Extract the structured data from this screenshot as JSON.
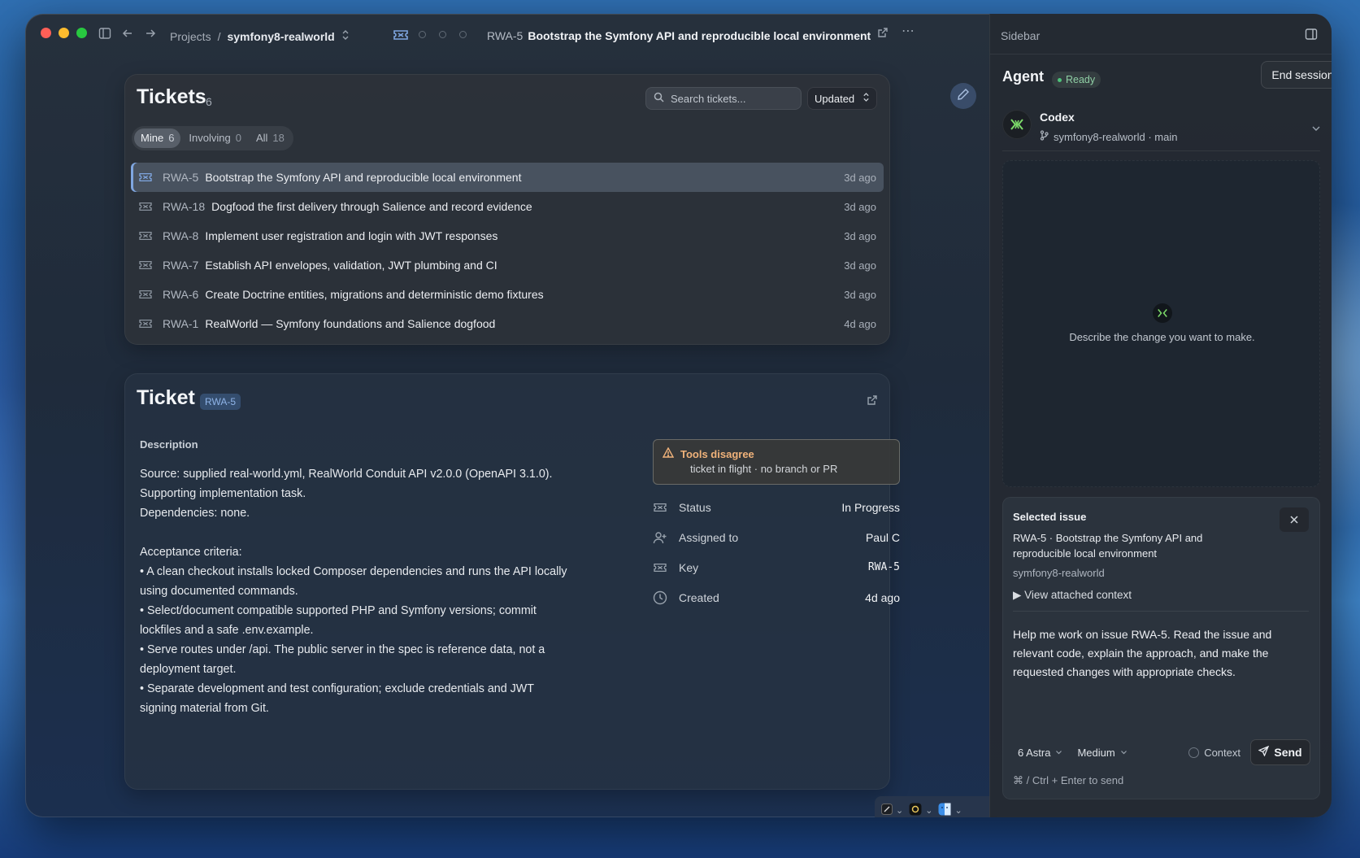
{
  "titlebar": {
    "breadcrumb_projects": "Projects",
    "breadcrumb_sep": "/",
    "breadcrumb_repo": "symfony8-realworld",
    "ticket_key": "RWA-5",
    "ticket_title": "Bootstrap the Symfony API and reproducible local environment"
  },
  "tickets": {
    "title": "Tickets",
    "count": "6",
    "search_placeholder": "Search tickets...",
    "sort_label": "Updated",
    "filters": [
      {
        "label": "Mine",
        "count": "6"
      },
      {
        "label": "Involving",
        "count": "0"
      },
      {
        "label": "All",
        "count": "18"
      }
    ],
    "rows": [
      {
        "key": "RWA-5",
        "title": "Bootstrap the Symfony API and reproducible local environment",
        "time": "3d ago"
      },
      {
        "key": "RWA-18",
        "title": "Dogfood the first delivery through Salience and record evidence",
        "time": "3d ago"
      },
      {
        "key": "RWA-8",
        "title": "Implement user registration and login with JWT responses",
        "time": "3d ago"
      },
      {
        "key": "RWA-7",
        "title": "Establish API envelopes, validation, JWT plumbing and CI",
        "time": "3d ago"
      },
      {
        "key": "RWA-6",
        "title": "Create Doctrine entities, migrations and deterministic demo fixtures",
        "time": "3d ago"
      },
      {
        "key": "RWA-1",
        "title": "RealWorld — Symfony foundations and Salience dogfood",
        "time": "4d ago"
      }
    ]
  },
  "ticket": {
    "title": "Ticket",
    "key": "RWA-5",
    "description_label": "Description",
    "description": "Source: supplied real-world.yml, RealWorld Conduit API v2.0.0 (OpenAPI 3.1.0).\nSupporting implementation task.\nDependencies: none.\n\nAcceptance criteria:\n• A clean checkout installs locked Composer dependencies and runs the API locally\nusing documented commands.\n• Select/document compatible supported PHP and Symfony versions; commit\nlockfiles and a safe .env.example.\n• Serve routes under /api. The public server in the spec is reference data, not a\ndeployment target.\n• Separate development and test configuration; exclude credentials and JWT\nsigning material from Git.",
    "warning_title": "Tools disagree",
    "warning_text": "ticket in flight · no branch or PR",
    "props": {
      "status_label": "Status",
      "status_value": "In Progress",
      "assigned_label": "Assigned to",
      "assigned_value": "Paul C",
      "key_label": "Key",
      "key_value": "RWA-5",
      "created_label": "Created",
      "created_value": "4d ago"
    }
  },
  "sidebar": {
    "title": "Sidebar",
    "agent_label": "Agent",
    "status": "Ready",
    "end_session": "End session",
    "agent_name": "Codex",
    "repo_branch": "symfony8-realworld · main",
    "empty_prompt": "Describe the change you want to make.",
    "selected_issue_title": "Selected issue",
    "selected_issue": "RWA-5 · Bootstrap the Symfony API and reproducible local environment",
    "selected_repo": "symfony8-realworld",
    "view_context": "View attached context",
    "message": "Help me work on issue RWA-5. Read the issue and relevant code, explain the approach, and make the requested changes with appropriate checks.",
    "model": "6 Astra",
    "effort": "Medium",
    "context": "Context",
    "send": "Send",
    "hint": "⌘ / Ctrl + Enter to send"
  },
  "colors": {
    "accent": "#7fa6e0",
    "ready_green": "#4ec27a",
    "warning": "#f0b27a"
  }
}
